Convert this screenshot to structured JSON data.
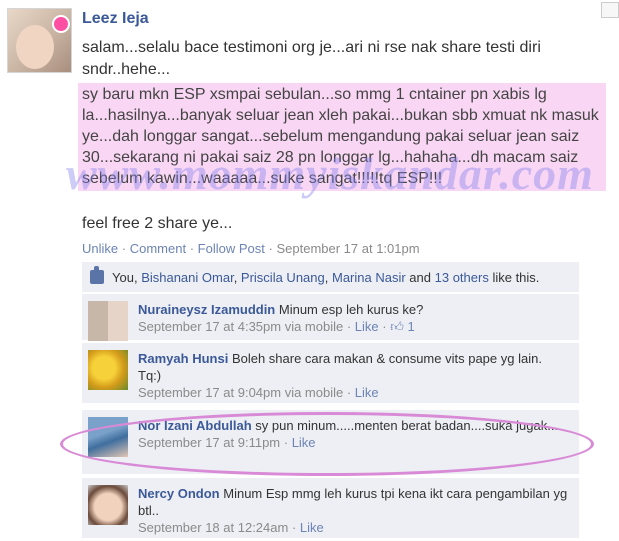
{
  "post": {
    "author": "Leez Ieja",
    "intro": "salam...selalu bace testimoni org je...ari ni rse nak share testi diri sndr..hehe...",
    "highlight": "sy baru mkn ESP xsmpai sebulan...so mmg 1 cntainer pn xabis lg la...hasilnya...banyak seluar jean xleh pakai...bukan sbb xmuat nk masuk ye...dah longgar sangat...sebelum mengandung pakai seluar jean saiz 30...sekarang ni pakai saiz 28 pn longgar lg...hahaha...dh macam saiz sebelum kawin...waaaaa...suke sangat!!!!!tq ESP!!!",
    "share_line": "feel free 2 share ye...",
    "watermark": "www.mommyiskandar.com",
    "actions": {
      "unlike": "Unlike",
      "comment": "Comment",
      "follow": "Follow Post",
      "time": "September 17 at 1:01pm",
      "sep": "·"
    }
  },
  "likes": {
    "you": "You,",
    "name1": "Bishanani Omar",
    "name2": "Priscila Unang",
    "name3": "Marina Nasir",
    "and": "and",
    "others": "13 others",
    "tail": "like this."
  },
  "comments": [
    {
      "name": "Nuraineysz Izamuddin",
      "text": "Minum esp leh kurus ke?",
      "time": "September 17 at 4:35pm via mobile",
      "like": "Like",
      "like_count": "1"
    },
    {
      "name": "Ramyah Hunsi",
      "text": "Boleh share cara makan & consume vits pape yg lain. Tq:)",
      "time": "September 17 at 9:04pm via mobile",
      "like": "Like"
    },
    {
      "name": "Nor Izani Abdullah",
      "text": "sy pun minum.....menten berat badan....suka jugak...",
      "time": "September 17 at 9:11pm",
      "like": "Like"
    },
    {
      "name": "Nercy Ondon",
      "text": "Minum Esp mmg leh kurus tpi kena ikt cara pengambilan yg btl..",
      "time": "September 18 at 12:24am",
      "like": "Like"
    }
  ],
  "colors": {
    "link": "#3b5998",
    "highlight": "#f9d7f4",
    "comment_bg": "#edeff4",
    "circle": "#d98ad6"
  }
}
